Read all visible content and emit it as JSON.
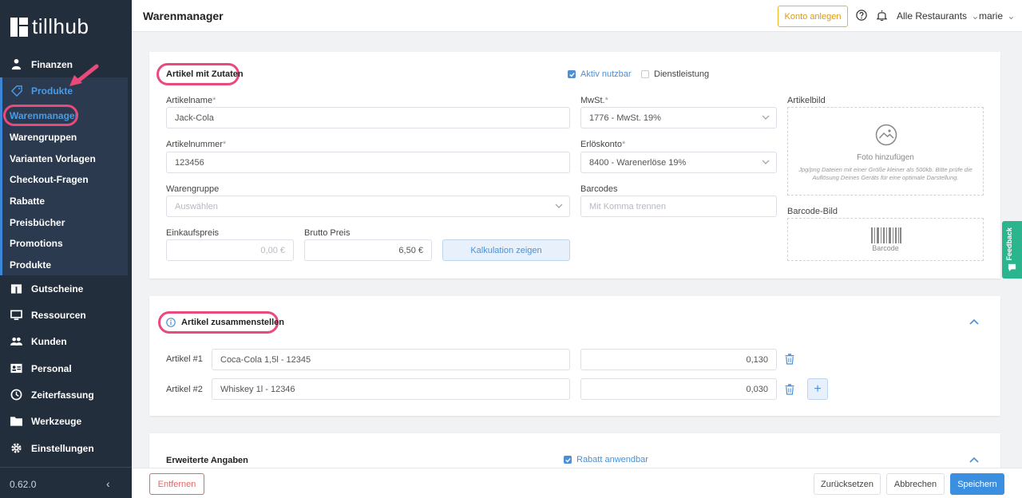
{
  "app": {
    "logo_text": "tillhub",
    "version": "0.62.0"
  },
  "sidebar": {
    "items": [
      {
        "label": "Finanzen",
        "icon": "piggy-icon"
      },
      {
        "label": "Produkte",
        "icon": "tag-icon"
      },
      {
        "label": "Gutscheine",
        "icon": "gift-icon"
      },
      {
        "label": "Ressourcen",
        "icon": "monitor-icon"
      },
      {
        "label": "Kunden",
        "icon": "users-icon"
      },
      {
        "label": "Personal",
        "icon": "id-card-icon"
      },
      {
        "label": "Zeiterfassung",
        "icon": "clock-icon"
      },
      {
        "label": "Werkzeuge",
        "icon": "folder-icon"
      },
      {
        "label": "Einstellungen",
        "icon": "gear-icon"
      }
    ],
    "sub_items": [
      "Warenmanager",
      "Warengruppen",
      "Varianten Vorlagen",
      "Checkout-Fragen",
      "Rabatte",
      "Preisbücher",
      "Promotions",
      "Produkte"
    ]
  },
  "topbar": {
    "title": "Warenmanager",
    "konto_label": "Konto anlegen",
    "restaurants": "Alle Restaurants",
    "user": "marie"
  },
  "article": {
    "section_title": "Artikel mit Zutaten",
    "aktiv_label": "Aktiv nutzbar",
    "dienst_label": "Dienstleistung",
    "name_label": "Artikelname",
    "name_value": "Jack-Cola",
    "number_label": "Artikelnummer",
    "number_value": "123456",
    "group_label": "Warengruppe",
    "group_placeholder": "Auswählen",
    "ek_label": "Einkaufspreis",
    "ek_placeholder": "0,00 €",
    "brutto_label": "Brutto Preis",
    "brutto_value": "6,50 €",
    "kalk_label": "Kalkulation zeigen",
    "mwst_label": "MwSt.",
    "mwst_value": "1776 - MwSt. 19%",
    "erloes_label": "Erlöskonto",
    "erloes_value": "8400 - Warenerlöse 19%",
    "barcodes_label": "Barcodes",
    "barcodes_placeholder": "Mit Komma trennen",
    "bild_label": "Artikelbild",
    "foto_label": "Foto hinzufügen",
    "foto_hint": "Jpg/png Dateien mit einer Größe kleiner als 500kb. Bitte prüfe die Auflösung Deines Geräts für eine optimale Darstellung.",
    "barcode_bild_label": "Barcode-Bild",
    "barcode_text": "Barcode",
    "required_mark": "*"
  },
  "compose": {
    "section_title": "Artikel zusammenstellen",
    "rows": [
      {
        "label": "Artikel #1",
        "item": "Coca-Cola 1,5l - 12345",
        "qty": "0,130"
      },
      {
        "label": "Artikel #2",
        "item": "Whiskey 1l - 12346",
        "qty": "0,030"
      }
    ]
  },
  "extended": {
    "section_title": "Erweiterte Angaben",
    "rabatt_label": "Rabatt anwendbar"
  },
  "footer": {
    "remove_label": "Entfernen",
    "reset_label": "Zurücksetzen",
    "cancel_label": "Abbrechen",
    "save_label": "Speichern"
  },
  "feedback_label": "Feedback",
  "colors": {
    "accent": "#4a90d9",
    "highlight": "#e94a7c",
    "sidebar": "#232e3c",
    "warning": "#f0b429",
    "danger": "#e06a6a"
  }
}
